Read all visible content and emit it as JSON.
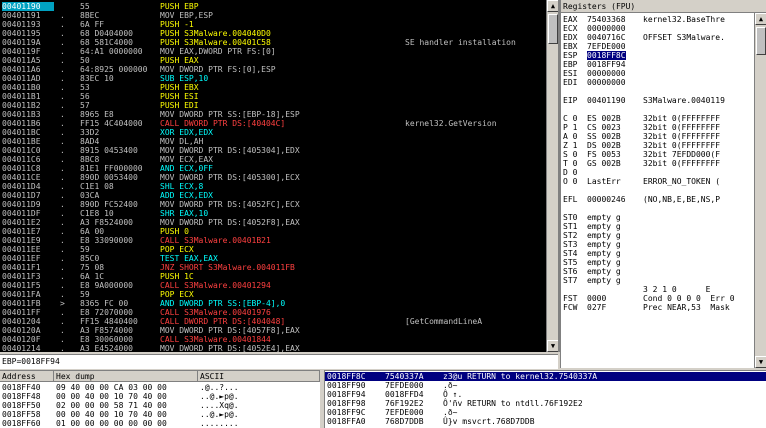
{
  "cpu": {
    "rows": [
      {
        "addr": "00401190",
        "mark": "",
        "hex": "55",
        "dis": "PUSH EBP",
        "cmt": "",
        "sel": true,
        "color": "#ffff00"
      },
      {
        "addr": "00401191",
        "mark": ".",
        "hex": "8BEC",
        "dis": "MOV EBP,ESP",
        "cmt": "",
        "color": "#c0c0c0"
      },
      {
        "addr": "00401193",
        "mark": ".",
        "hex": "6A FF",
        "dis": "PUSH -1",
        "cmt": "",
        "color": "#ffff00"
      },
      {
        "addr": "00401195",
        "mark": ".",
        "hex": "68 D0404000",
        "dis": "PUSH S3Malware.004040D0",
        "cmt": "",
        "color": "#ffff00"
      },
      {
        "addr": "0040119A",
        "mark": ".",
        "hex": "68 581C4000",
        "dis": "PUSH S3Malware.00401C58",
        "cmt": "SE handler installation",
        "color": "#ffff00"
      },
      {
        "addr": "0040119F",
        "mark": ".",
        "hex": "64:A1 0000000",
        "dis": "MOV EAX,DWORD PTR FS:[0]",
        "cmt": "",
        "color": "#c0c0c0"
      },
      {
        "addr": "004011A5",
        "mark": ".",
        "hex": "50",
        "dis": "PUSH EAX",
        "cmt": "",
        "color": "#ffff00"
      },
      {
        "addr": "004011A6",
        "mark": ".",
        "hex": "64:8925 000000",
        "dis": "MOV DWORD PTR FS:[0],ESP",
        "cmt": "",
        "color": "#c0c0c0"
      },
      {
        "addr": "004011AD",
        "mark": ".",
        "hex": "83EC 10",
        "dis": "SUB ESP,10",
        "cmt": "",
        "color": "#00ffff"
      },
      {
        "addr": "004011B0",
        "mark": ".",
        "hex": "53",
        "dis": "PUSH EBX",
        "cmt": "",
        "color": "#ffff00"
      },
      {
        "addr": "004011B1",
        "mark": ".",
        "hex": "56",
        "dis": "PUSH ESI",
        "cmt": "",
        "color": "#ffff00"
      },
      {
        "addr": "004011B2",
        "mark": ".",
        "hex": "57",
        "dis": "PUSH EDI",
        "cmt": "",
        "color": "#ffff00"
      },
      {
        "addr": "004011B3",
        "mark": ".",
        "hex": "8965 E8",
        "dis": "MOV DWORD PTR SS:[EBP-18],ESP",
        "cmt": "",
        "color": "#c0c0c0"
      },
      {
        "addr": "004011B6",
        "mark": ".",
        "hex": "FF15 4C404000",
        "dis": "CALL DWORD PTR DS:[40404C]",
        "cmt": "kernel32.GetVersion",
        "color": "#ff4040"
      },
      {
        "addr": "004011BC",
        "mark": ".",
        "hex": "33D2",
        "dis": "XOR EDX,EDX",
        "cmt": "",
        "color": "#00ffff"
      },
      {
        "addr": "004011BE",
        "mark": ".",
        "hex": "8AD4",
        "dis": "MOV DL,AH",
        "cmt": "",
        "color": "#c0c0c0"
      },
      {
        "addr": "004011C0",
        "mark": ".",
        "hex": "8915 0453400",
        "dis": "MOV DWORD PTR DS:[405304],EDX",
        "cmt": "",
        "color": "#c0c0c0"
      },
      {
        "addr": "004011C6",
        "mark": ".",
        "hex": "8BC8",
        "dis": "MOV ECX,EAX",
        "cmt": "",
        "color": "#c0c0c0"
      },
      {
        "addr": "004011C8",
        "mark": ".",
        "hex": "81E1 FF000000",
        "dis": "AND ECX,0FF",
        "cmt": "",
        "color": "#00ffff"
      },
      {
        "addr": "004011CE",
        "mark": ".",
        "hex": "890D 0053400",
        "dis": "MOV DWORD PTR DS:[405300],ECX",
        "cmt": "",
        "color": "#c0c0c0"
      },
      {
        "addr": "004011D4",
        "mark": ".",
        "hex": "C1E1 08",
        "dis": "SHL ECX,8",
        "cmt": "",
        "color": "#00ffff"
      },
      {
        "addr": "004011D7",
        "mark": ".",
        "hex": "03CA",
        "dis": "ADD ECX,EDX",
        "cmt": "",
        "color": "#00ffff"
      },
      {
        "addr": "004011D9",
        "mark": ".",
        "hex": "890D FC52400",
        "dis": "MOV DWORD PTR DS:[4052FC],ECX",
        "cmt": "",
        "color": "#c0c0c0"
      },
      {
        "addr": "004011DF",
        "mark": ".",
        "hex": "C1E8 10",
        "dis": "SHR EAX,10",
        "cmt": "",
        "color": "#00ffff"
      },
      {
        "addr": "004011E2",
        "mark": ".",
        "hex": "A3 F8524000",
        "dis": "MOV DWORD PTR DS:[4052F8],EAX",
        "cmt": "",
        "color": "#c0c0c0"
      },
      {
        "addr": "004011E7",
        "mark": ".",
        "hex": "6A 00",
        "dis": "PUSH 0",
        "cmt": "",
        "color": "#ffff00"
      },
      {
        "addr": "004011E9",
        "mark": ".",
        "hex": "E8 33090000",
        "dis": "CALL S3Malware.00401B21",
        "cmt": "",
        "color": "#ff4040"
      },
      {
        "addr": "004011EE",
        "mark": ".",
        "hex": "59",
        "dis": "POP ECX",
        "cmt": "",
        "color": "#ffff00"
      },
      {
        "addr": "004011EF",
        "mark": ".",
        "hex": "85C0",
        "dis": "TEST EAX,EAX",
        "cmt": "",
        "color": "#00ffff"
      },
      {
        "addr": "004011F1",
        "mark": ".",
        "hex": "75 08",
        "dis": "JNZ SHORT S3Malware.004011FB",
        "cmt": "",
        "color": "#ff4040"
      },
      {
        "addr": "004011F3",
        "mark": ".",
        "hex": "6A 1C",
        "dis": "PUSH 1C",
        "cmt": "",
        "color": "#ffff00"
      },
      {
        "addr": "004011F5",
        "mark": ".",
        "hex": "E8 9A000000",
        "dis": "CALL S3Malware.00401294",
        "cmt": "",
        "color": "#ff4040"
      },
      {
        "addr": "004011FA",
        "mark": ".",
        "hex": "59",
        "dis": "POP ECX",
        "cmt": "",
        "color": "#ffff00"
      },
      {
        "addr": "004011FB",
        "mark": ">",
        "hex": "8365 FC 00",
        "dis": "AND DWORD PTR SS:[EBP-4],0",
        "cmt": "",
        "color": "#00ffff"
      },
      {
        "addr": "004011FF",
        "mark": ".",
        "hex": "E8 72070000",
        "dis": "CALL S3Malware.00401976",
        "cmt": "",
        "color": "#ff4040"
      },
      {
        "addr": "00401204",
        "mark": ".",
        "hex": "FF15 4840400",
        "dis": "CALL DWORD PTR DS:[404048]",
        "cmt": "[GetCommandLineA",
        "color": "#ff4040"
      },
      {
        "addr": "0040120A",
        "mark": ".",
        "hex": "A3 F8574000",
        "dis": "MOV DWORD PTR DS:[4057F8],EAX",
        "cmt": "",
        "color": "#c0c0c0"
      },
      {
        "addr": "0040120F",
        "mark": ".",
        "hex": "E8 30060000",
        "dis": "CALL S3Malware.00401844",
        "cmt": "",
        "color": "#ff4040"
      },
      {
        "addr": "00401214",
        "mark": ".",
        "hex": "A3 E4524000",
        "dis": "MOV DWORD PTR DS:[4052E4],EAX",
        "cmt": "",
        "color": "#c0c0c0"
      }
    ]
  },
  "info": {
    "text": "EBP=0018FF94"
  },
  "registers": {
    "title": "Registers (FPU)",
    "rows": [
      {
        "n": "EAX",
        "v": "75403368",
        "c": "kernel32.BaseThre",
        "hl": false
      },
      {
        "n": "ECX",
        "v": "00000000",
        "c": "",
        "hl": false
      },
      {
        "n": "EDX",
        "v": "0040716C",
        "c": "OFFSET S3Malware.",
        "hl": false
      },
      {
        "n": "EBX",
        "v": "7EFDE000",
        "c": "",
        "hl": false
      },
      {
        "n": "ESP",
        "v": "0018FF8C",
        "c": "",
        "hl": true
      },
      {
        "n": "EBP",
        "v": "0018FF94",
        "c": "",
        "hl": false
      },
      {
        "n": "ESI",
        "v": "00000000",
        "c": "",
        "hl": false
      },
      {
        "n": "EDI",
        "v": "00000000",
        "c": "",
        "hl": false
      },
      {
        "n": "",
        "v": "",
        "c": "",
        "hl": false
      },
      {
        "n": "EIP",
        "v": "00401190",
        "c": "S3Malware.0040119",
        "hl": false
      },
      {
        "n": "",
        "v": "",
        "c": "",
        "hl": false
      },
      {
        "n": "C 0",
        "v": "ES 002B",
        "c": "32bit 0(FFFFFFFF",
        "hl": false
      },
      {
        "n": "P 1",
        "v": "CS 0023",
        "c": "32bit 0(FFFFFFFF",
        "hl": false
      },
      {
        "n": "A 0",
        "v": "SS 002B",
        "c": "32bit 0(FFFFFFFF",
        "hl": false
      },
      {
        "n": "Z 1",
        "v": "DS 002B",
        "c": "32bit 0(FFFFFFFF",
        "hl": false
      },
      {
        "n": "S 0",
        "v": "FS 0053",
        "c": "32bit 7EFDD000(F",
        "hl": false
      },
      {
        "n": "T 0",
        "v": "GS 002B",
        "c": "32bit 0(FFFFFFFF",
        "hl": false
      },
      {
        "n": "D 0",
        "v": "",
        "c": "",
        "hl": false
      },
      {
        "n": "O 0",
        "v": "LastErr",
        "c": "ERROR_NO_TOKEN (",
        "hl": false
      },
      {
        "n": "",
        "v": "",
        "c": "",
        "hl": false
      },
      {
        "n": "EFL",
        "v": "00000246",
        "c": "(NO,NB,E,BE,NS,P",
        "hl": false
      },
      {
        "n": "",
        "v": "",
        "c": "",
        "hl": false
      },
      {
        "n": "ST0",
        "v": "empty g",
        "c": "",
        "hl": false
      },
      {
        "n": "ST1",
        "v": "empty g",
        "c": "",
        "hl": false
      },
      {
        "n": "ST2",
        "v": "empty g",
        "c": "",
        "hl": false
      },
      {
        "n": "ST3",
        "v": "empty g",
        "c": "",
        "hl": false
      },
      {
        "n": "ST4",
        "v": "empty g",
        "c": "",
        "hl": false
      },
      {
        "n": "ST5",
        "v": "empty g",
        "c": "",
        "hl": false
      },
      {
        "n": "ST6",
        "v": "empty g",
        "c": "",
        "hl": false
      },
      {
        "n": "ST7",
        "v": "empty g",
        "c": "",
        "hl": false
      },
      {
        "n": "",
        "v": "",
        "c": "3 2 1 0      E",
        "hl": false
      },
      {
        "n": "FST",
        "v": "0000",
        "c": "Cond 0 0 0 0  Err 0",
        "hl": false
      },
      {
        "n": "FCW",
        "v": "027F",
        "c": "Prec NEAR,53  Mask",
        "hl": false
      }
    ]
  },
  "dump": {
    "headers": [
      "Address",
      "Hex dump",
      "ASCII"
    ],
    "rows": [
      {
        "a": "0018FF40",
        "h": "09 40 00 00 CA 03 00 00",
        "s": ".@..?..."
      },
      {
        "a": "0018FF48",
        "h": "00 00 40 00 10 70 40 00",
        "s": "..@.►p@."
      },
      {
        "a": "0018FF50",
        "h": "02 00 00 00 58 71 40 00",
        "s": "....Xq@."
      },
      {
        "a": "0018FF58",
        "h": "00 00 40 00 10 70 40 00",
        "s": "..@.►p@."
      },
      {
        "a": "0018FF60",
        "h": "01 00 00 00 00 00 00 00",
        "s": "........"
      }
    ]
  },
  "stack": {
    "rows": [
      {
        "a": "0018FF8C",
        "v": "7540337A",
        "t": "z3@u RETURN to kernel32.7540337A",
        "sel": true
      },
      {
        "a": "0018FF90",
        "v": "7EFDE000",
        "t": ".ð~",
        "sel": false
      },
      {
        "a": "0018FF94",
        "v": "0018FFD4",
        "t": "Ô ↑.",
        "sel": false
      },
      {
        "a": "0018FF98",
        "v": "76F192E2",
        "t": "Ô'ñv RETURN to ntdll.76F192E2",
        "sel": false
      },
      {
        "a": "0018FF9C",
        "v": "7EFDE000",
        "t": ".ð~",
        "sel": false
      },
      {
        "a": "0018FFA0",
        "v": "768D7DDB",
        "t": "Û}v msvcrt.768D7DDB",
        "sel": false
      }
    ]
  }
}
